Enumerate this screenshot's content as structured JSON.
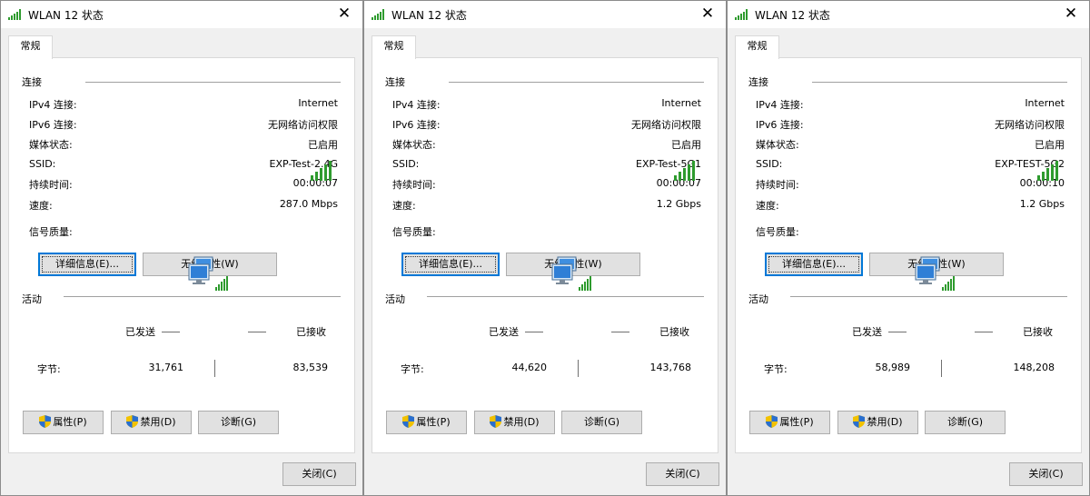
{
  "labels": {
    "tab": "常规",
    "group_connection": "连接",
    "ipv4": "IPv4 连接:",
    "ipv6": "IPv6 连接:",
    "media": "媒体状态:",
    "ssid": "SSID:",
    "duration": "持续时间:",
    "speed": "速度:",
    "signal": "信号质量:",
    "details_button": "详细信息(E)...",
    "wireless_props_button": "无线属性(W)",
    "group_activity": "活动",
    "sent": "已发送",
    "received": "已接收",
    "bytes": "字节:",
    "properties_button": "属性(P)",
    "disable_button": "禁用(D)",
    "diagnose_button": "诊断(G)",
    "close_button": "关闭(C)"
  },
  "icons": {
    "title": "wifi-signal-icon",
    "close": "close-icon",
    "signal": "signal-bars-icon",
    "network": "network-computers-icon",
    "shield": "uac-shield-icon"
  },
  "colors": {
    "signal_green": "#2e9b2e",
    "focus_blue": "#0078d7"
  },
  "windows": [
    {
      "title": "WLAN 12 状态",
      "ipv4": "Internet",
      "ipv6": "无网络访问权限",
      "media": "已启用",
      "ssid": "EXP-Test-2.4G",
      "duration": "00:00:07",
      "speed": "287.0 Mbps",
      "signal_bars": 5,
      "bytes_sent": "31,761",
      "bytes_received": "83,539"
    },
    {
      "title": "WLAN 12 状态",
      "ipv4": "Internet",
      "ipv6": "无网络访问权限",
      "media": "已启用",
      "ssid": "EXP-Test-5G1",
      "duration": "00:00:07",
      "speed": "1.2 Gbps",
      "signal_bars": 5,
      "bytes_sent": "44,620",
      "bytes_received": "143,768"
    },
    {
      "title": "WLAN 12 状态",
      "ipv4": "Internet",
      "ipv6": "无网络访问权限",
      "media": "已启用",
      "ssid": "EXP-TEST-5G2",
      "duration": "00:00:10",
      "speed": "1.2 Gbps",
      "signal_bars": 5,
      "bytes_sent": "58,989",
      "bytes_received": "148,208"
    }
  ]
}
